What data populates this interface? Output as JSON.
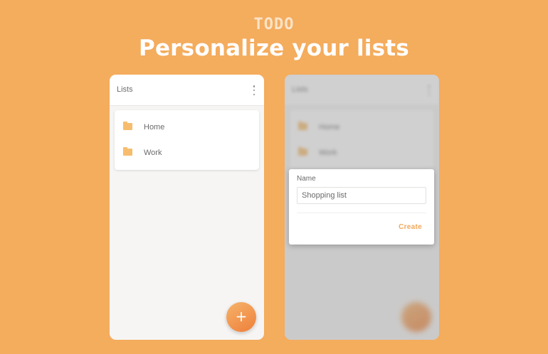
{
  "header": {
    "brand": "TODO",
    "headline": "Personalize your lists"
  },
  "screen_lists": {
    "appbar_title": "Lists",
    "menu_icon": "kebab-menu-icon",
    "items": [
      {
        "label": "Home",
        "icon": "folder-icon"
      },
      {
        "label": "Work",
        "icon": "folder-icon"
      }
    ],
    "fab_label": "+"
  },
  "screen_dialog": {
    "appbar_title": "Lists",
    "items": [
      {
        "label": "Home"
      },
      {
        "label": "Work"
      }
    ],
    "dialog": {
      "field_label": "Name",
      "input_value": "Shopping list",
      "action_label": "Create"
    }
  },
  "colors": {
    "background": "#f4ac5d",
    "accent": "#f2a85a",
    "folder": "#f7bd6f"
  }
}
